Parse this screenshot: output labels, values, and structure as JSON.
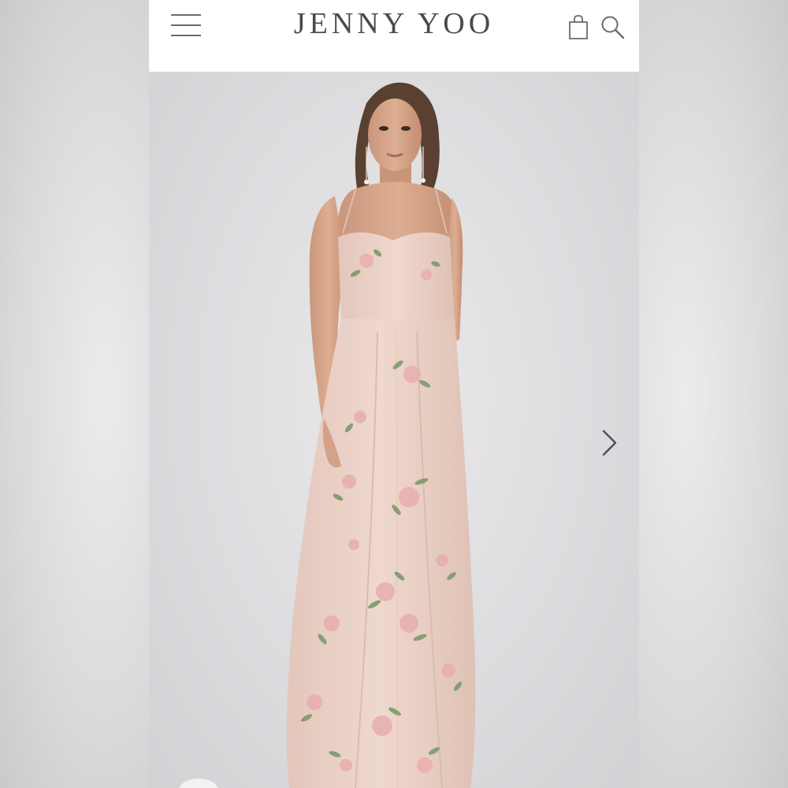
{
  "header": {
    "brand": "JENNY YOO",
    "menu_icon": "hamburger-menu-icon",
    "bag_icon": "shopping-bag-icon",
    "search_icon": "search-icon"
  },
  "hero": {
    "image": "model-floral-embroidered-gown",
    "next_icon": "chevron-right-icon"
  },
  "colors": {
    "header_bg": "#ffffff",
    "brand_text": "#4a4a4a",
    "icon": "#6b6b6b",
    "hero_bg": "#dedde0",
    "dress": "#ecd3c8"
  }
}
